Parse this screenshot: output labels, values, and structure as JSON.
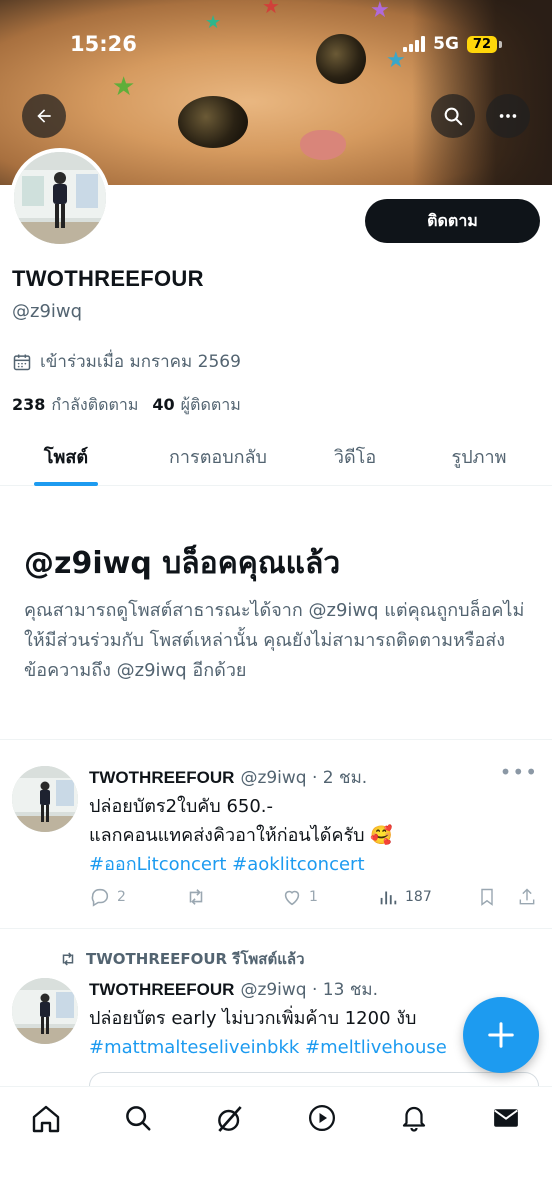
{
  "status_bar": {
    "time": "15:26",
    "network": "5G",
    "battery": "72"
  },
  "profile": {
    "display_name": "TWOTHREEFOUR",
    "handle": "@z9iwq",
    "joined": "เข้าร่วมเมื่อ มกราคม 2569",
    "following_count": "238",
    "following_label": "กำลังติดตาม",
    "followers_count": "40",
    "followers_label": "ผู้ติดตาม",
    "follow_button": "ติดตาม"
  },
  "tabs": [
    {
      "label": "โพสต์",
      "active": true
    },
    {
      "label": "การตอบกลับ",
      "active": false
    },
    {
      "label": "วิดีโอ",
      "active": false
    },
    {
      "label": "รูปภาพ",
      "active": false
    }
  ],
  "blocked": {
    "title": "@z9iwq บล็อคคุณแล้ว",
    "body": "คุณสามารถดูโพสต์สาธารณะได้จาก @z9iwq แต่คุณถูกบล็อคไม่ให้มีส่วนร่วมกับ โพสต์เหล่านั้น คุณยังไม่สามารถติดตามหรือส่งข้อความถึง @z9iwq อีกด้วย"
  },
  "tweets": [
    {
      "name": "TWOTHREEFOUR",
      "meta": "@z9iwq · 2 ชม.",
      "line1": "ปล่อยบัตร2ใบคับ 650.-",
      "line2": "แลกคอนแทคส่งคิวอาให้ก่อนได้ครับ 🥰",
      "hashtags": "#ออกLitconcert #aoklitconcert",
      "replies": "2",
      "retweets": "",
      "likes": "1",
      "views": "187"
    },
    {
      "retweet_label": "TWOTHREEFOUR รีโพสต์แล้ว",
      "name": "TWOTHREEFOUR",
      "meta": "@z9iwq · 13 ชม.",
      "line1": "ปล่อยบัตร early ไม่บวกเพิ่มค้าบ 1200 งับ",
      "hashtags": "#mattmalteseliveinbkk #meltlivehouse"
    }
  ],
  "colors": {
    "accent": "#1d9bf0",
    "text": "#0f1419",
    "muted": "#536471"
  },
  "icons": {
    "back": "arrow-left-icon",
    "search": "search-icon",
    "more": "more-horizontal-icon",
    "calendar": "calendar-icon",
    "compose": "plus-icon",
    "nav": [
      "home-icon",
      "search-icon",
      "grok-icon",
      "play-icon",
      "bell-icon",
      "mail-icon"
    ]
  }
}
